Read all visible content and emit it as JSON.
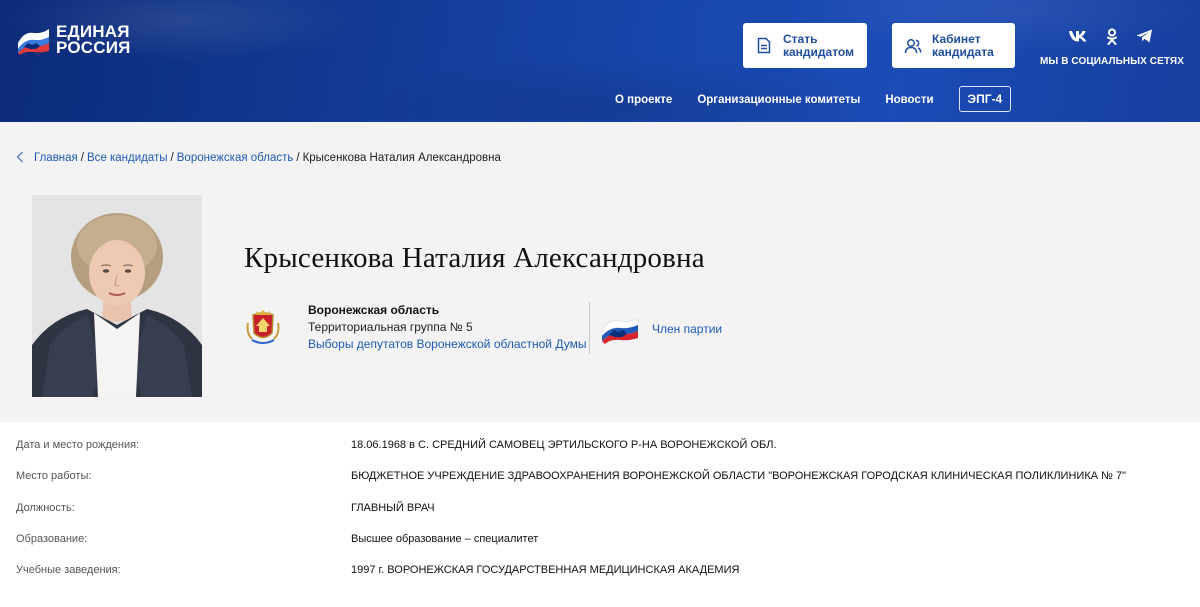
{
  "header": {
    "logo": {
      "line1": "ЕДИНАЯ",
      "line2": "РОССИЯ"
    },
    "buttons": {
      "become_candidate": "Стать кандидатом",
      "candidate_cabinet": "Кабинет кандидата"
    },
    "social": {
      "label": "МЫ В СОЦИАЛЬНЫХ СЕТЯХ",
      "icons": [
        "vk-icon",
        "odnoklassniki-icon",
        "telegram-icon"
      ]
    },
    "nav": {
      "about": "О проекте",
      "committees": "Организационные комитеты",
      "news": "Новости",
      "epg": "ЭПГ-4"
    }
  },
  "breadcrumb": {
    "home": "Главная",
    "all_candidates": "Все кандидаты",
    "region": "Воронежская область",
    "current": "Крысенкова Наталия Александровна",
    "separator": "/"
  },
  "profile": {
    "name": "Крысенкова Наталия Александровна",
    "region_title": "Воронежская область",
    "group": "Территориальная группа № 5",
    "elections_link": "Выборы депутатов Воронежской областной Думы",
    "membership": "Член партии"
  },
  "details": [
    {
      "label": "Дата и место рождения:",
      "value": "18.06.1968 в С. СРЕДНИЙ САМОВЕЦ ЭРТИЛЬСКОГО Р-НА ВОРОНЕЖСКОЙ ОБЛ."
    },
    {
      "label": "Место работы:",
      "value": "БЮДЖЕТНОЕ УЧРЕЖДЕНИЕ ЗДРАВООХРАНЕНИЯ ВОРОНЕЖСКОЙ ОБЛАСТИ \"ВОРОНЕЖСКАЯ ГОРОДСКАЯ КЛИНИЧЕСКАЯ ПОЛИКЛИНИКА № 7\""
    },
    {
      "label": "Должность:",
      "value": "ГЛАВНЫЙ ВРАЧ"
    },
    {
      "label": "Образование:",
      "value": "Высшее образование – специалитет"
    },
    {
      "label": "Учебные заведения:",
      "value": "1997 г. ВОРОНЕЖСКАЯ ГОСУДАРСТВЕННАЯ МЕДИЦИНСКАЯ АКАДЕМИЯ"
    }
  ],
  "colors": {
    "header_blue": "#1746ad",
    "link_blue": "#1f5bb6",
    "button_text": "#1f4e9f",
    "profile_bg": "#f3f3f3"
  }
}
